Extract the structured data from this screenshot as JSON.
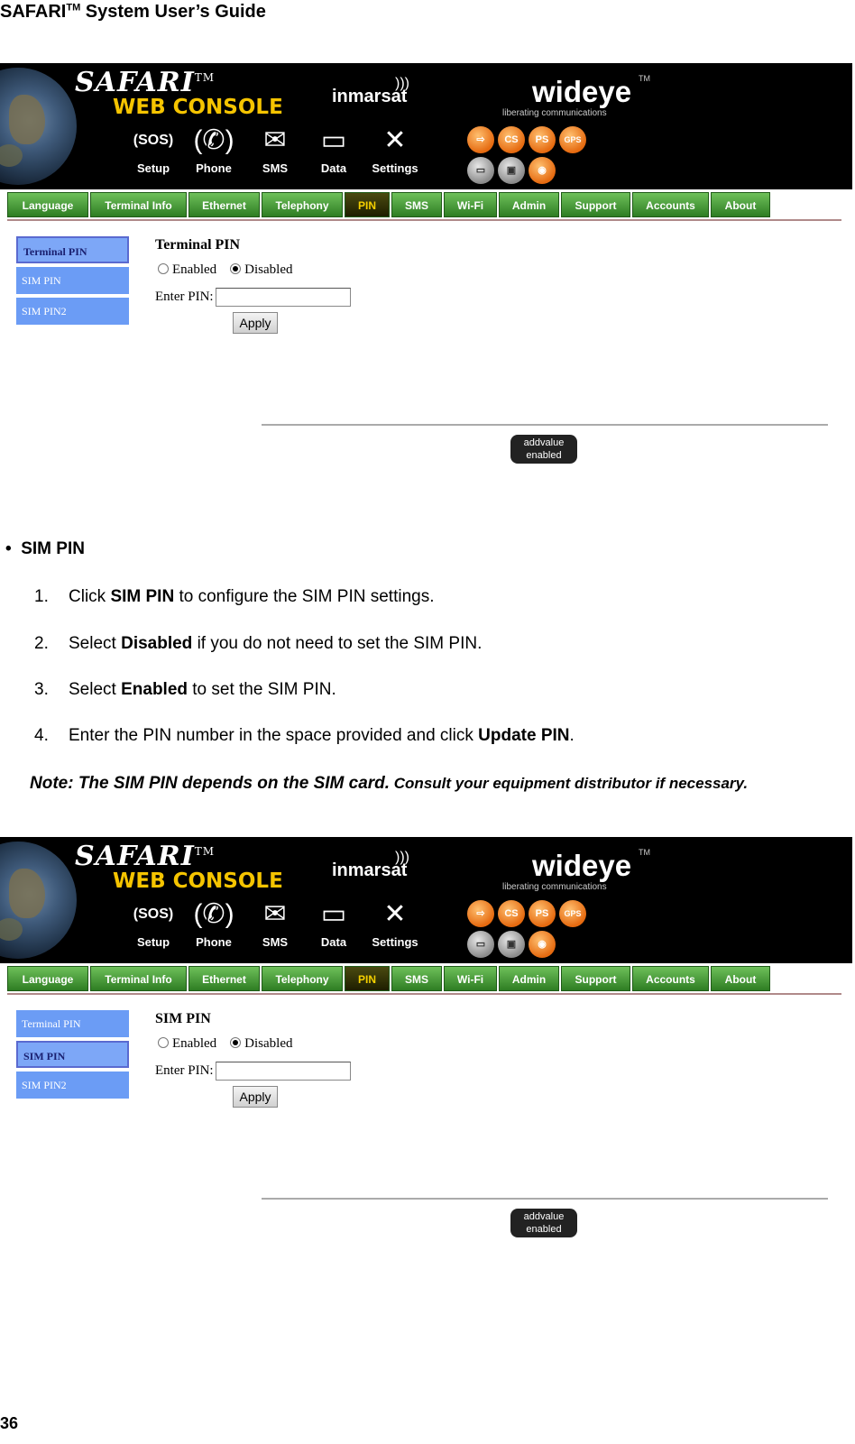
{
  "doc": {
    "header_main": "SAFARI",
    "header_tm": "TM",
    "header_rest": " System User’s Guide",
    "page_number": "36"
  },
  "console": {
    "logo": "SAFARI",
    "logo_tm": "TM",
    "subtitle": "WEB CONSOLE",
    "partner": "inmarsat",
    "brand": "wideye",
    "brand_tm": "TM",
    "tagline": "liberating communications",
    "nav": [
      {
        "label": "Setup",
        "icon": "sos-icon"
      },
      {
        "label": "Phone",
        "icon": "phone-icon"
      },
      {
        "label": "SMS",
        "icon": "envelope-icon"
      },
      {
        "label": "Data",
        "icon": "computer-icon"
      },
      {
        "label": "Settings",
        "icon": "tools-icon"
      }
    ],
    "status": {
      "cs": "CS",
      "ps": "PS",
      "gps": "GPS"
    },
    "tabs": [
      "Language",
      "Terminal Info",
      "Ethernet",
      "Telephony",
      "PIN",
      "SMS",
      "Wi-Fi",
      "Admin",
      "Support",
      "Accounts",
      "About"
    ],
    "active_tab": "PIN",
    "sidebar": [
      "Terminal PIN",
      "SIM PIN",
      "SIM PIN2"
    ],
    "radio_enabled": "Enabled",
    "radio_disabled": "Disabled",
    "pin_label": "Enter PIN:",
    "apply": "Apply",
    "badge_top": "addvalue",
    "badge_bottom": "enabled"
  },
  "screen1": {
    "title": "Terminal PIN",
    "active_sidebar": "Terminal PIN",
    "selected": "Disabled"
  },
  "screen2": {
    "title": "SIM PIN",
    "active_sidebar": "SIM PIN",
    "selected": "Disabled"
  },
  "section": {
    "heading": "SIM PIN",
    "steps": [
      {
        "num": "1.",
        "pre": "Click ",
        "bold": "SIM PIN",
        "post": " to configure the SIM PIN settings."
      },
      {
        "num": "2.",
        "pre": "Select ",
        "bold": "Disabled",
        "post": " if you do not need to set the SIM PIN."
      },
      {
        "num": "3.",
        "pre": "Select ",
        "bold": "Enabled",
        "post": " to set the SIM PIN."
      },
      {
        "num": "4.",
        "pre": "Enter the PIN number in the space provided and click ",
        "bold": "Update PIN",
        "post": "."
      }
    ],
    "note_large": "Note: The SIM PIN depends on the SIM card.",
    "note_small": " Consult your equipment distributor if necessary."
  }
}
